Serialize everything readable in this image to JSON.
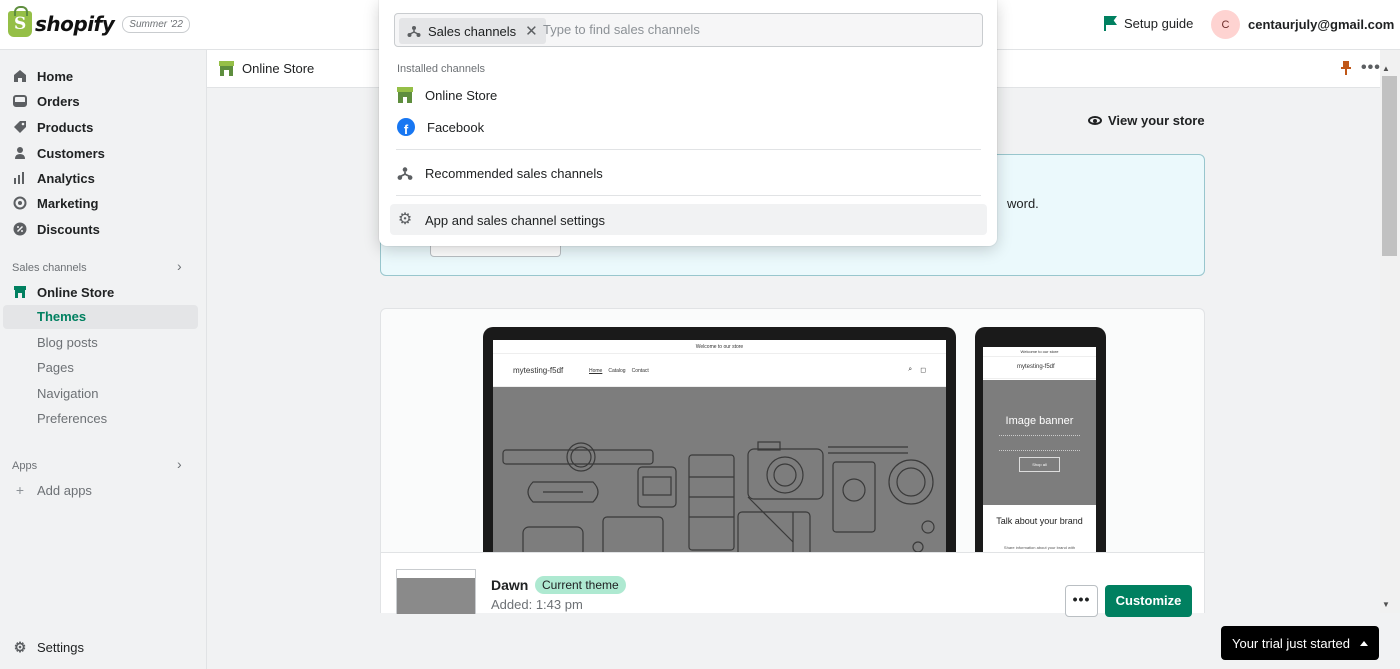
{
  "topbar": {
    "brand": "shopify",
    "edition": "Summer '22",
    "setup_guide": "Setup guide",
    "avatar_initial": "C",
    "account_email": "centaurjuly@gmail.com"
  },
  "sidebar": {
    "items": [
      {
        "label": "Home",
        "icon": "home-icon"
      },
      {
        "label": "Orders",
        "icon": "orders-icon"
      },
      {
        "label": "Products",
        "icon": "tag-icon"
      },
      {
        "label": "Customers",
        "icon": "person-icon"
      },
      {
        "label": "Analytics",
        "icon": "bar-chart-icon"
      },
      {
        "label": "Marketing",
        "icon": "target-icon"
      },
      {
        "label": "Discounts",
        "icon": "discount-icon"
      }
    ],
    "sales_channels_header": "Sales channels",
    "online_store": "Online Store",
    "sub_items": [
      "Themes",
      "Blog posts",
      "Pages",
      "Navigation",
      "Preferences"
    ],
    "active_sub": "Themes",
    "apps_header": "Apps",
    "add_apps": "Add apps",
    "settings": "Settings"
  },
  "main": {
    "header_title": "Online Store",
    "view_store": "View your store",
    "banner_text": "word.",
    "theme": {
      "name": "Dawn",
      "badge": "Current theme",
      "added": "Added: 1:43 pm",
      "more": "•••",
      "customize": "Customize"
    },
    "preview": {
      "announcement": "Welcome to our store",
      "store_name": "mytesting-f5df",
      "nav": [
        "Home",
        "Catalog",
        "Contact"
      ],
      "image_banner": "Image banner",
      "shop_all": "Shop all",
      "talk_about": "Talk about your brand",
      "talk_sub": "Share information about your brand with"
    }
  },
  "dropdown": {
    "tag_label": "Sales channels",
    "search_placeholder": "Type to find sales channels",
    "installed_header": "Installed channels",
    "installed": [
      {
        "label": "Online Store",
        "icon": "online-store-icon"
      },
      {
        "label": "Facebook",
        "icon": "facebook-icon"
      }
    ],
    "recommended": "Recommended sales channels",
    "settings": "App and sales channel settings"
  },
  "trial": {
    "label": "Your trial just started"
  },
  "colors": {
    "accent": "#008060",
    "badge": "#aee9d1",
    "banner_bg": "#ebf9fc",
    "facebook": "#1877f2"
  }
}
